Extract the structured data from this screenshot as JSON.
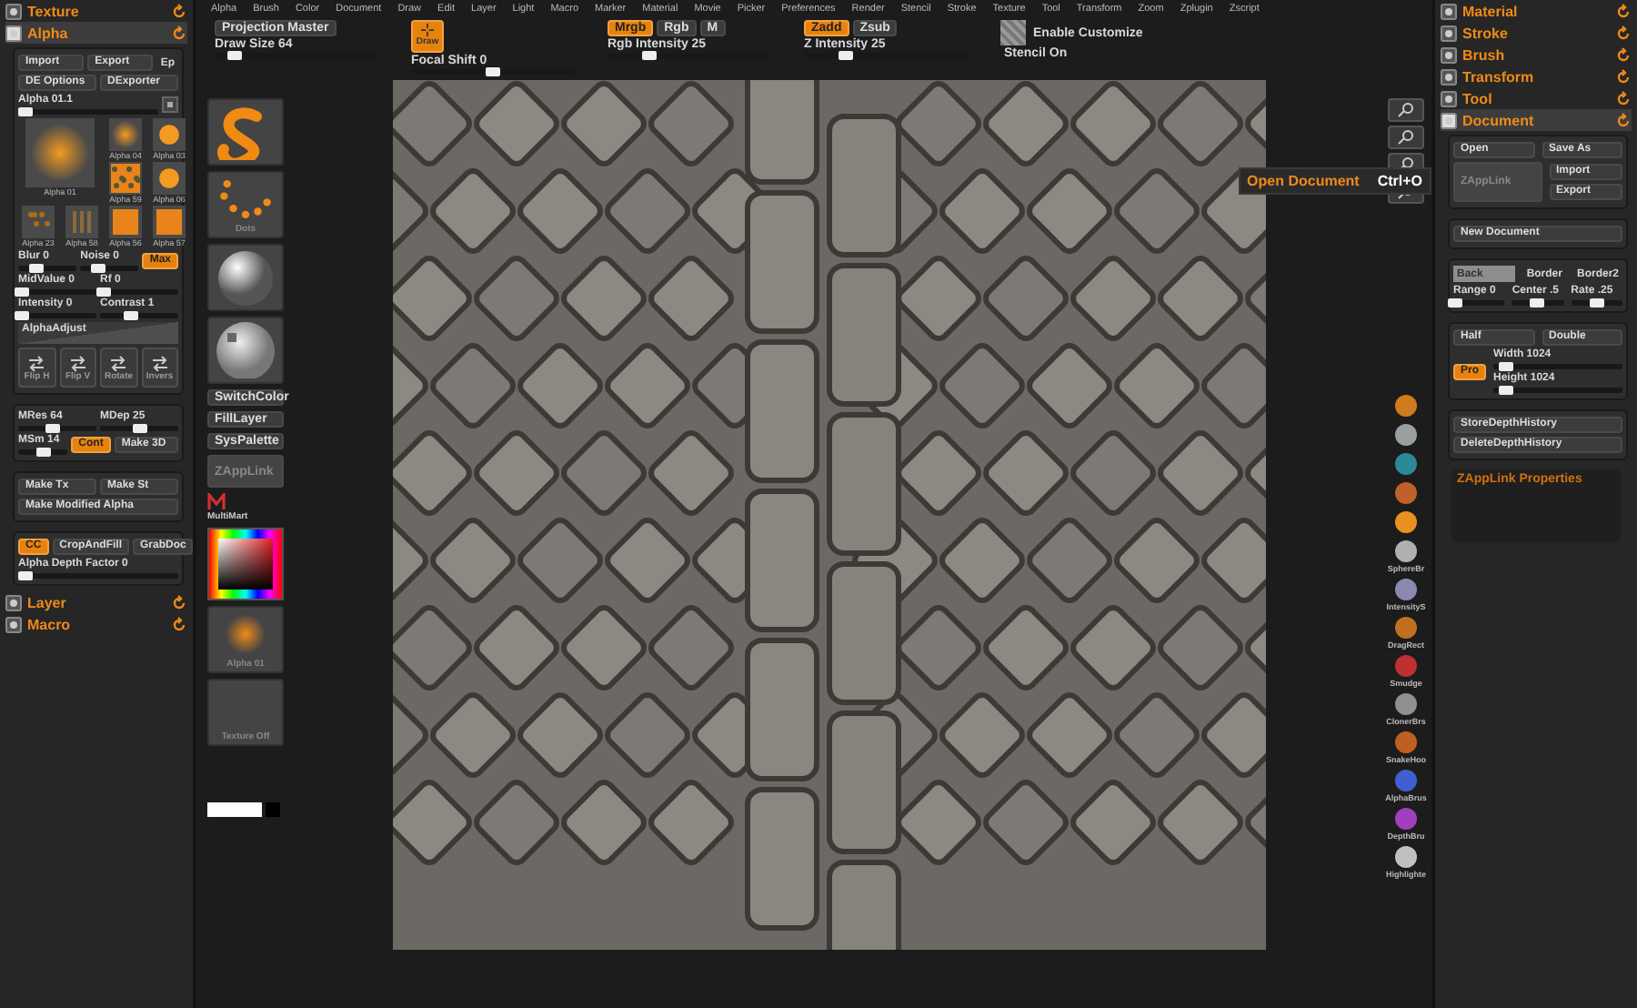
{
  "menu": [
    "Alpha",
    "Brush",
    "Color",
    "Document",
    "Draw",
    "Edit",
    "Layer",
    "Light",
    "Macro",
    "Marker",
    "Material",
    "Movie",
    "Picker",
    "Preferences",
    "Render",
    "Stencil",
    "Stroke",
    "Texture",
    "Tool",
    "Transform",
    "Zoom",
    "Zplugin",
    "Zscript"
  ],
  "toolbar": {
    "groups": [
      {
        "top": [
          {
            "kind": "button",
            "label": "Projection Master"
          }
        ],
        "bottom": [
          {
            "kind": "slider",
            "label": "Draw Size",
            "value": "64",
            "level": 0.12
          }
        ]
      },
      {
        "top": [
          {
            "kind": "tool",
            "label": "Draw",
            "on": true
          }
        ],
        "bottom": [
          {
            "kind": "slider",
            "label": "Focal Shift",
            "value": "0",
            "level": 0.5
          }
        ]
      },
      {
        "top": [
          {
            "kind": "toggle",
            "label": "Mrgb",
            "on": true
          },
          {
            "kind": "toggle",
            "label": "Rgb",
            "on": false
          },
          {
            "kind": "toggle",
            "label": "M",
            "on": false
          }
        ],
        "bottom": [
          {
            "kind": "slider",
            "label": "Rgb Intensity",
            "value": "25",
            "level": 0.25
          }
        ]
      },
      {
        "top": [
          {
            "kind": "toggle",
            "label": "Zadd",
            "on": true
          },
          {
            "kind": "toggle",
            "label": "Zsub",
            "on": false
          }
        ],
        "bottom": [
          {
            "kind": "slider",
            "label": "Z Intensity",
            "value": "25",
            "level": 0.25
          }
        ]
      },
      {
        "top": [
          {
            "kind": "texture"
          },
          {
            "kind": "text",
            "label": "Enable Customize"
          }
        ],
        "bottom": [
          {
            "kind": "text",
            "label": "Stencil On"
          }
        ]
      }
    ]
  },
  "left_panel": {
    "palettes": [
      {
        "title": "Texture",
        "expanded": false
      },
      {
        "title": "Alpha",
        "expanded": true,
        "groups": [
          [
            [
              {
                "kind": "button",
                "label": "Import"
              },
              {
                "kind": "button",
                "label": "Export"
              },
              {
                "kind": "text",
                "label": "Ep"
              }
            ],
            [
              {
                "kind": "button",
                "label": "DE Options"
              },
              {
                "kind": "button",
                "label": "DExporter"
              }
            ],
            [
              {
                "kind": "slider",
                "label": "Alpha 01.1",
                "level": 0.05
              },
              {
                "kind": "icon"
              }
            ],
            [
              {
                "kind": "grid",
                "items": [
                  {
                    "label": "Alpha 01",
                    "kind": "blob",
                    "large": true
                  },
                  {
                    "label": "Alpha 04",
                    "kind": "blob",
                    "large": false
                  },
                  {
                    "label": "Alpha 03",
                    "kind": "dot",
                    "large": false
                  },
                  {
                    "label": "Alpha 59",
                    "kind": "noise",
                    "large": false
                  },
                  {
                    "label": "Alpha 06",
                    "kind": "dot",
                    "large": false
                  },
                  {
                    "label": "Alpha 23",
                    "kind": "speckle",
                    "large": false
                  },
                  {
                    "label": "Alpha 58",
                    "kind": "stripes",
                    "large": false
                  },
                  {
                    "label": "Alpha 56",
                    "kind": "square",
                    "large": false
                  },
                  {
                    "label": "Alpha 57",
                    "kind": "square",
                    "large": false
                  }
                ]
              }
            ],
            [
              {
                "kind": "slider",
                "label": "Blur",
                "value": "0",
                "level": 0.3
              },
              {
                "kind": "slider",
                "label": "Noise",
                "value": "0",
                "level": 0.3
              },
              {
                "kind": "toggle",
                "label": "Max",
                "on": true
              }
            ],
            [
              {
                "kind": "slider",
                "label": "MidValue",
                "value": "0",
                "level": 0.05
              },
              {
                "kind": "slider",
                "label": "Rf",
                "value": "0",
                "level": 0.05
              }
            ],
            [
              {
                "kind": "slider",
                "label": "Intensity",
                "value": "0",
                "level": 0.05
              },
              {
                "kind": "slider",
                "label": "Contrast",
                "value": "1",
                "level": 0.4
              }
            ],
            [
              {
                "kind": "curve",
                "label": "AlphaAdjust"
              }
            ],
            [
              {
                "kind": "iconbutton",
                "label": "Flip H"
              },
              {
                "kind": "iconbutton",
                "label": "Flip V"
              },
              {
                "kind": "iconbutton",
                "label": "Rotate"
              },
              {
                "kind": "iconbutton",
                "label": "Invers"
              }
            ]
          ],
          [
            [
              {
                "kind": "slider",
                "label": "MRes",
                "value": "64",
                "level": 0.45
              },
              {
                "kind": "slider",
                "label": "MDep",
                "value": "25",
                "level": 0.5
              }
            ],
            [
              {
                "kind": "slider",
                "label": "MSm",
                "value": "14",
                "level": 0.5
              },
              {
                "kind": "toggle",
                "label": "Cont",
                "on": true
              },
              {
                "kind": "button",
                "label": "Make 3D"
              }
            ]
          ],
          [
            [
              {
                "kind": "button",
                "label": "Make Tx"
              },
              {
                "kind": "button",
                "label": "Make St"
              }
            ],
            [
              {
                "kind": "button",
                "label": "Make Modified Alpha"
              }
            ]
          ],
          [
            [
              {
                "kind": "toggle",
                "label": "CC",
                "on": true
              },
              {
                "kind": "button",
                "label": "CropAndFill"
              },
              {
                "kind": "button",
                "label": "GrabDoc"
              }
            ],
            [
              {
                "kind": "slider",
                "label": "Alpha Depth Factor",
                "value": "0",
                "level": 0.05
              }
            ]
          ]
        ]
      },
      {
        "title": "Layer",
        "expanded": false
      },
      {
        "title": "Macro",
        "expanded": false
      }
    ]
  },
  "left_shelf": [
    {
      "kind": "snake"
    },
    {
      "kind": "dots",
      "label": "Dots"
    },
    {
      "kind": "sphere"
    },
    {
      "kind": "shiny"
    },
    {
      "kind": "button",
      "label": "SwitchColor"
    },
    {
      "kind": "button",
      "label": "FillLayer"
    },
    {
      "kind": "button",
      "label": "SysPalette"
    },
    {
      "kind": "ghost",
      "label": "ZAppLink"
    },
    {
      "kind": "marker",
      "label": "MultiMart"
    },
    {
      "kind": "picker"
    },
    {
      "kind": "blob",
      "label": "Alpha 01"
    },
    {
      "kind": "empty",
      "label": "Texture Off"
    },
    {
      "kind": "swatches"
    }
  ],
  "tooltip": {
    "title": "Open Document",
    "shortcut": "Ctrl+O"
  },
  "right_shelf": [
    {
      "kind": "view"
    },
    {
      "kind": "view"
    },
    {
      "kind": "view"
    },
    {
      "kind": "view"
    },
    {
      "kind": "brush",
      "color": "#d07a1e"
    },
    {
      "kind": "brush",
      "color": "#9aa0a0"
    },
    {
      "kind": "brush",
      "color": "#2a8a9a"
    },
    {
      "kind": "brush",
      "color": "#c0602a"
    },
    {
      "kind": "brush",
      "color": "#e89020"
    },
    {
      "kind": "brush",
      "label": "SphereBr",
      "color": "#b0b0b0"
    },
    {
      "kind": "brush",
      "label": "IntensityS",
      "color": "#8a8ab0"
    },
    {
      "kind": "brush",
      "label": "DragRect",
      "color": "#c07020"
    },
    {
      "kind": "brush",
      "label": "Smudge",
      "color": "#c03030"
    },
    {
      "kind": "brush",
      "label": "ClonerBrs",
      "color": "#909090"
    },
    {
      "kind": "brush",
      "label": "SnakeHoo",
      "color": "#c06020"
    },
    {
      "kind": "brush",
      "label": "AlphaBrus",
      "color": "#4060d0"
    },
    {
      "kind": "brush",
      "label": "DepthBru",
      "color": "#a040c0"
    },
    {
      "kind": "brush",
      "label": "Highlighte",
      "color": "#c0c0c0"
    }
  ],
  "right_panel": {
    "palettes": [
      {
        "title": "Material",
        "expanded": false
      },
      {
        "title": "Stroke",
        "expanded": false
      },
      {
        "title": "Brush",
        "expanded": false
      },
      {
        "title": "Transform",
        "expanded": false
      },
      {
        "title": "Tool",
        "expanded": false
      },
      {
        "title": "Document",
        "expanded": true,
        "groups": [
          [
            [
              {
                "kind": "button",
                "label": "Open"
              },
              {
                "kind": "button",
                "label": "Save As"
              }
            ],
            [
              {
                "kind": "ghost",
                "label": "ZAppLink"
              },
              {
                "kind": "stack",
                "items": [
                  {
                    "kind": "button",
                    "label": "Import"
                  },
                  {
                    "kind": "button",
                    "label": "Export"
                  }
                ]
              }
            ]
          ],
          [
            [
              {
                "kind": "button",
                "label": "New Document"
              }
            ]
          ],
          [
            [
              {
                "kind": "swatch",
                "label": "Back"
              },
              {
                "kind": "text",
                "label": "Border"
              },
              {
                "kind": "text",
                "label": "Border2"
              }
            ],
            [
              {
                "kind": "slider",
                "label": "Range",
                "value": "0",
                "level": 0.05
              },
              {
                "kind": "slider",
                "label": "Center",
                "value": ".5",
                "level": 0.5
              },
              {
                "kind": "slider",
                "label": "Rate",
                "value": ".25",
                "level": 0.5
              }
            ]
          ],
          [
            [
              {
                "kind": "button",
                "label": "Half"
              },
              {
                "kind": "button",
                "label": "Double"
              }
            ],
            [
              {
                "kind": "toggle",
                "label": "Pro",
                "on": true
              },
              {
                "kind": "stack",
                "items": [
                  {
                    "kind": "slider",
                    "label": "Width",
                    "value": "1024",
                    "level": 0.1
                  },
                  {
                    "kind": "slider",
                    "label": "Height",
                    "value": "1024",
                    "level": 0.1
                  }
                ]
              }
            ]
          ],
          [
            [
              {
                "kind": "button",
                "label": "StoreDepthHistory"
              }
            ],
            [
              {
                "kind": "button",
                "label": "DeleteDepthHistory"
              }
            ]
          ]
        ],
        "subheader": "ZAppLink Properties"
      }
    ]
  }
}
